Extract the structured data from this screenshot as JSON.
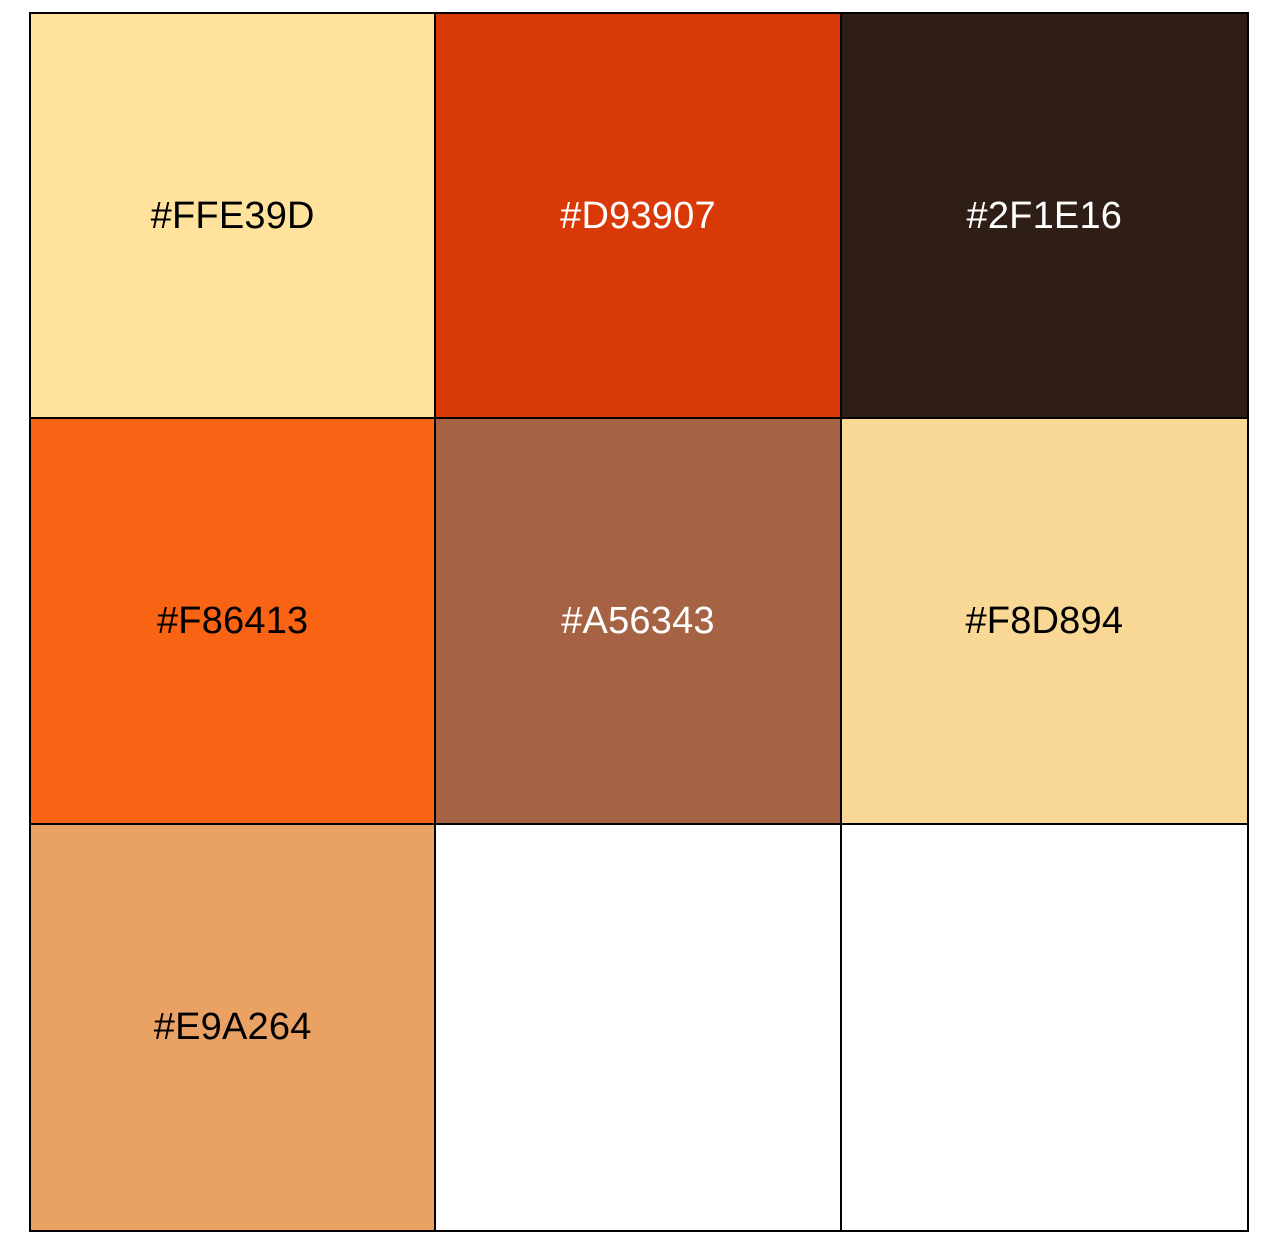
{
  "swatches": [
    {
      "hex": "#FFE39D",
      "color": "#FFE39D",
      "text_color": "#000000"
    },
    {
      "hex": "#D93907",
      "color": "#D93907",
      "text_color": "#FFFFFF"
    },
    {
      "hex": "#2F1E16",
      "color": "#2F1E16",
      "text_color": "#FFFFFF"
    },
    {
      "hex": "#F86413",
      "color": "#F86413",
      "text_color": "#000000"
    },
    {
      "hex": "#A56343",
      "color": "#A56343",
      "text_color": "#FFFFFF"
    },
    {
      "hex": "#F8D894",
      "color": "#F8D894",
      "text_color": "#000000"
    },
    {
      "hex": "#E9A264",
      "color": "#E9A264",
      "text_color": "#000000"
    },
    {
      "hex": "",
      "color": "#FFFFFF",
      "text_color": "#000000"
    },
    {
      "hex": "",
      "color": "#FFFFFF",
      "text_color": "#000000"
    }
  ]
}
